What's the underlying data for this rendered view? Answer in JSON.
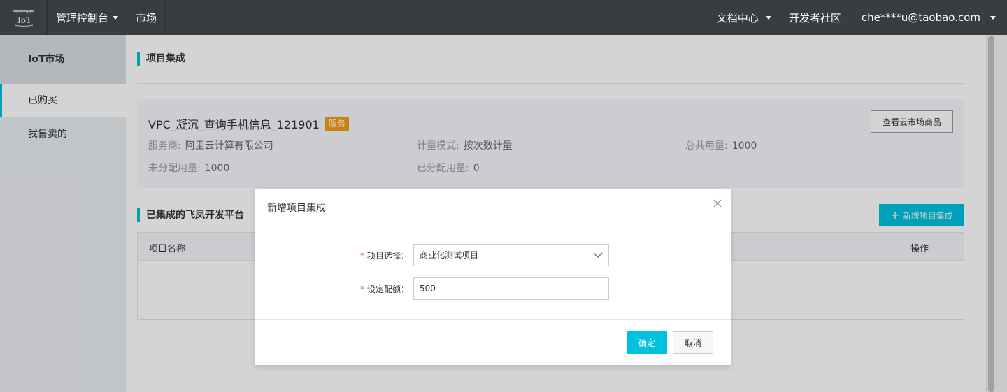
{
  "topbar": {
    "logo_icon": "iot-logo-icon",
    "console_label": "管理控制台",
    "market_label": "市场",
    "docs_label": "文档中心",
    "community_label": "开发者社区",
    "user_label": "che****u@taobao.com"
  },
  "sidebar": {
    "title": "IoT市场",
    "items": [
      {
        "label": "已购买",
        "active": true
      },
      {
        "label": "我售卖的",
        "active": false
      }
    ]
  },
  "main": {
    "section1_title": "项目集成",
    "card": {
      "name": "VPC_凝沉_查询手机信息_121901",
      "tag": "服务",
      "view_button": "查看云市场商品",
      "provider_label": "服务商:",
      "provider_value": "阿里云计算有限公司",
      "metering_label": "计量模式:",
      "metering_value": "按次数计量",
      "total_label": "总共用量:",
      "total_value": "1000",
      "unassigned_label": "未分配用量:",
      "unassigned_value": "1000",
      "assigned_label": "已分配用量:",
      "assigned_value": "0"
    },
    "section2_title": "已集成的飞凤开发平台",
    "add_button": "新增项目集成",
    "table": {
      "col_name": "项目名称",
      "col_action": "操作"
    }
  },
  "dialog": {
    "title": "新增项目集成",
    "project_label": "项目选择：",
    "project_value": "商业化测试项目",
    "quota_label": "设定配额：",
    "quota_value": "500",
    "required_mark": "*",
    "ok_button": "确定",
    "cancel_button": "取消"
  },
  "colors": {
    "accent": "#00c1de",
    "tag": "#f39c12",
    "topbar": "#373d41"
  }
}
